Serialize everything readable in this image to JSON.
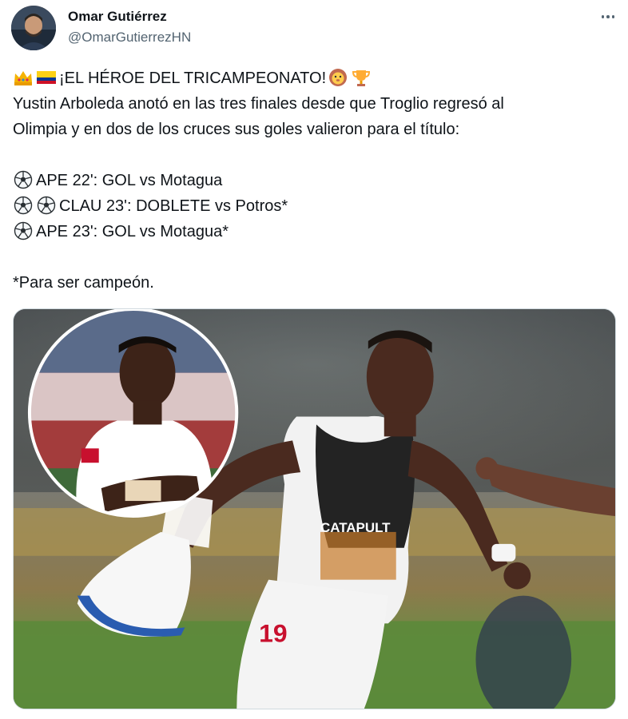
{
  "author": {
    "display_name": "Omar Gutiérrez",
    "handle": "@OmarGutierrezHN"
  },
  "tweet": {
    "headline": "¡EL HÉROE DEL TRICAMPEONATO!",
    "headline_lead_icons": [
      "crown-emoji",
      "colombia-flag-emoji"
    ],
    "headline_trail_icons": [
      "lion-face-emoji",
      "trophy-emoji"
    ],
    "body_line_1": "Yustin Arboleda anotó en las tres finales desde que Troglio regresó al",
    "body_line_2": "Olimpia y en dos de los cruces sus goles valieron para el título:",
    "goals": [
      {
        "icons": [
          "soccer-ball-emoji"
        ],
        "text": "APE 22': GOL vs Motagua"
      },
      {
        "icons": [
          "soccer-ball-emoji",
          "soccer-ball-emoji"
        ],
        "text": "CLAU 23': DOBLETE vs Potros*"
      },
      {
        "icons": [
          "soccer-ball-emoji"
        ],
        "text": "APE 23': GOL vs Motagua*"
      }
    ],
    "footnote": "*Para ser campeón."
  },
  "media": {
    "jersey_sponsor": "CATAPULT",
    "jersey_number": "19"
  },
  "icons": {
    "more": "more-options-icon"
  },
  "colors": {
    "text": "#0f1419",
    "secondary": "#536471",
    "border": "#cfd9de"
  }
}
